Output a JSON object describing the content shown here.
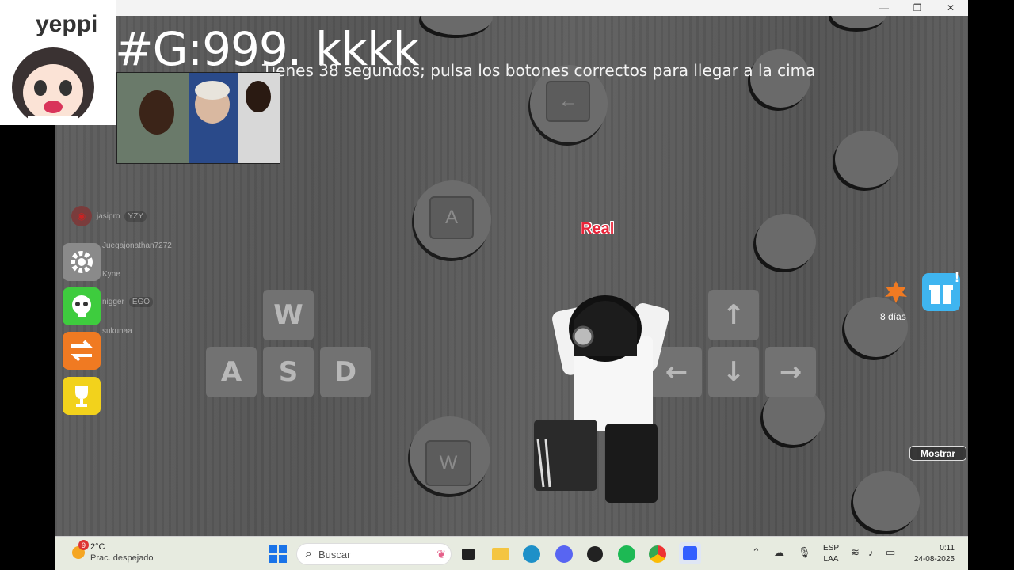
{
  "window": {
    "minimize": "—",
    "restore": "❐",
    "close": "✕"
  },
  "overlay": {
    "sticker_text": "yeppi",
    "big_text_left": "#G:999.",
    "big_text_right": "kkkk"
  },
  "game": {
    "message": "Tienes 38 segundos; pulsa los botones correctos para llegar a la cima",
    "real_label": "Real",
    "pad_left_arrow": "←",
    "pad_a": "A",
    "pad_w": "W",
    "wasd": {
      "w": "W",
      "a": "A",
      "s": "S",
      "d": "D"
    },
    "arrows": {
      "up": "↑",
      "left": "←",
      "down": "↓",
      "right": "→"
    },
    "event_days": "8 días",
    "mostrar_label": "Mostrar"
  },
  "players": [
    {
      "name": "jasipro",
      "tag": "YZY"
    },
    {
      "name": "Juegajonathan7272",
      "tag": ""
    },
    {
      "name": "Kyne",
      "tag": ""
    },
    {
      "name": "nigger",
      "tag": "EGO"
    },
    {
      "name": "sukunaa",
      "tag": ""
    }
  ],
  "taskbar": {
    "weather_temp": "2°C",
    "weather_desc": "Prac. despejado",
    "weather_badge": "9",
    "search_placeholder": "Buscar",
    "lang_top": "ESP",
    "lang_bottom": "LAA",
    "time": "0:11",
    "date": "24-08-2025"
  },
  "colors": {
    "real_label": "#e8253a",
    "discord": "#5865f2",
    "gift": "#3fb5f0",
    "trophy": "#f2d21c",
    "swap": "#f07a22",
    "green": "#3ecc3e"
  }
}
